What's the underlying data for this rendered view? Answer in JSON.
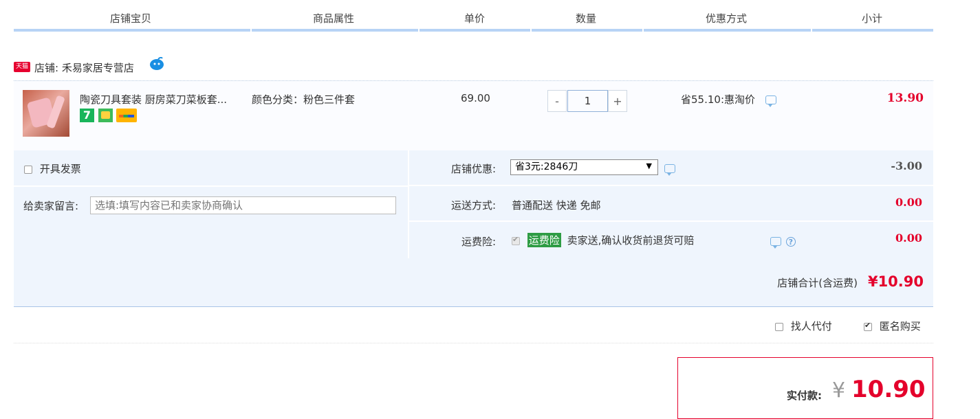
{
  "header": {
    "columns": [
      "店铺宝贝",
      "商品属性",
      "单价",
      "数量",
      "优惠方式",
      "小计"
    ]
  },
  "shop": {
    "badge": "天猫",
    "name": "店铺: 禾易家居专营店",
    "chat_icon": "wangwang-icon"
  },
  "item": {
    "title": "陶瓷刀具套装 厨房菜刀菜板套...",
    "attribute": "颜色分类：粉色三件套",
    "unit_price": "69.00",
    "qty_minus": "-",
    "quantity": "1",
    "qty_plus": "+",
    "discount": "省55.10:惠淘价",
    "subtotal": "13.90",
    "badges": [
      "7"
    ]
  },
  "options": {
    "invoice_label": "开具发票",
    "message_label": "给卖家留言:",
    "message_placeholder": "选填:填写内容已和卖家协商确认",
    "shop_promo_label": "店铺优惠:",
    "shop_promo_value": "省3元:2846刀",
    "shop_promo_amount": "-3.00",
    "shipping_label": "运送方式:",
    "shipping_value": "普通配送 快递 免邮",
    "shipping_amount": "0.00",
    "insurance_label": "运费险:",
    "insurance_badge": "运费险",
    "insurance_text": "卖家送,确认收货前退货可赔",
    "insurance_amount": "0.00"
  },
  "total": {
    "label": "店铺合计(含运费)",
    "amount": "¥10.90"
  },
  "extras": {
    "pay_for_me": "找人代付",
    "anonymous": "匿名购买"
  },
  "pay": {
    "label": "实付款:",
    "currency": "¥",
    "amount": "10.90"
  },
  "colors": {
    "accent_red": "#e4002b",
    "header_bar": "#b7d3f5",
    "panel_bg": "#eff5fd",
    "insurance_green": "#2e9c44"
  }
}
